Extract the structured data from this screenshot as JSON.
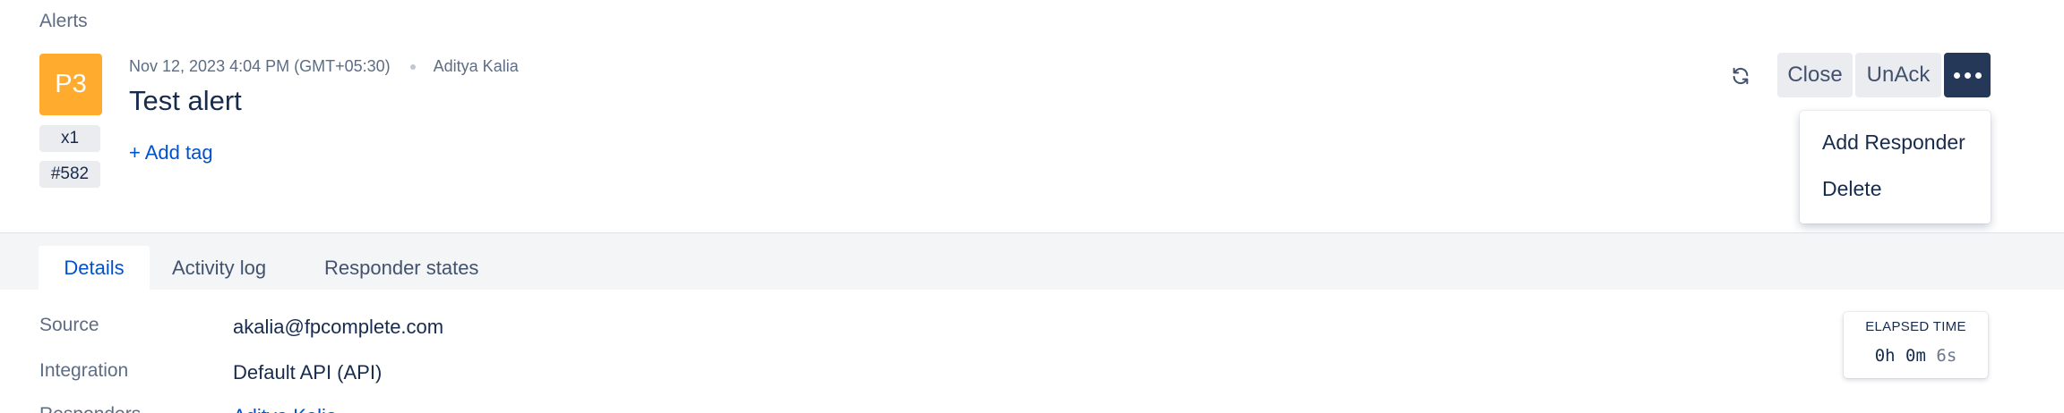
{
  "breadcrumb": "Alerts",
  "alert": {
    "priority": "P3",
    "count": "x1",
    "tiny_id": "#582",
    "created": "Nov 12, 2023 4:04 PM (GMT+05:30)",
    "owner": "Aditya Kalia",
    "title": "Test alert",
    "add_tag": "+ Add tag"
  },
  "actions": {
    "close": "Close",
    "unack": "UnAck"
  },
  "dropdown": {
    "items": [
      "Add Responder",
      "Delete"
    ]
  },
  "tabs": [
    {
      "label": "Details",
      "active": true
    },
    {
      "label": "Activity log",
      "active": false
    },
    {
      "label": "Responder states",
      "active": false
    }
  ],
  "details": {
    "source_label": "Source",
    "source_value": "akalia@fpcomplete.com",
    "integration_label": "Integration",
    "integration_value": "Default API (API)",
    "responders_label": "Responders",
    "responders_value": "Aditya Kalia"
  },
  "elapsed": {
    "title": "ELAPSED TIME",
    "hours_minutes": "0h 0m",
    "seconds": "6s"
  },
  "colors": {
    "priority_p3": "#ffab2e",
    "primary_dark": "#253858",
    "link": "#0052cc",
    "tab_band": "#f4f5f7"
  }
}
